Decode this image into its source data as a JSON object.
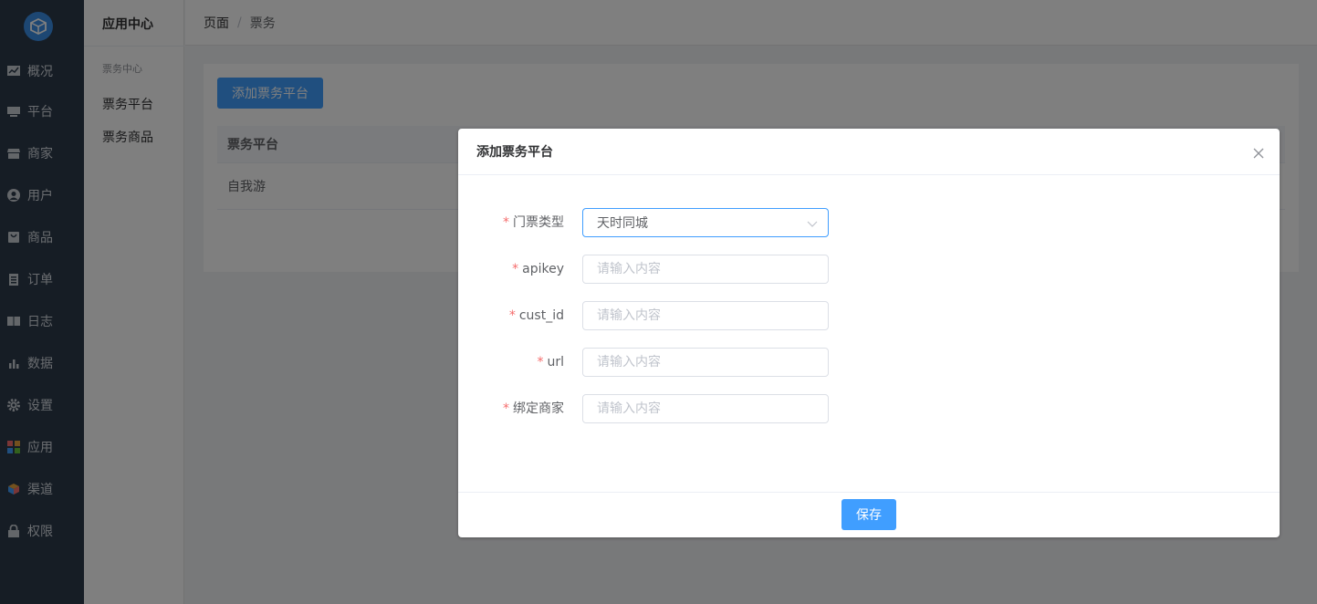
{
  "sidebar": {
    "items": [
      {
        "label": "概况",
        "icon": "chart-icon"
      },
      {
        "label": "平台",
        "icon": "monitor-icon"
      },
      {
        "label": "商家",
        "icon": "shop-icon"
      },
      {
        "label": "用户",
        "icon": "user-icon"
      },
      {
        "label": "商品",
        "icon": "bag-icon"
      },
      {
        "label": "订单",
        "icon": "clipboard-icon"
      },
      {
        "label": "日志",
        "icon": "book-icon"
      },
      {
        "label": "数据",
        "icon": "bar-chart-icon"
      },
      {
        "label": "设置",
        "icon": "gear-icon"
      },
      {
        "label": "应用",
        "icon": "grid-apps-icon"
      },
      {
        "label": "渠道",
        "icon": "cube-icon"
      },
      {
        "label": "权限",
        "icon": "lock-icon"
      }
    ]
  },
  "subnav": {
    "title": "应用中心",
    "group": "票务中心",
    "items": [
      "票务平台",
      "票务商品"
    ]
  },
  "breadcrumb": {
    "root": "页面",
    "separator": "/",
    "current": "票务"
  },
  "main": {
    "add_button": "添加票务平台",
    "table": {
      "header": "票务平台",
      "rows": [
        "自我游"
      ]
    }
  },
  "dialog": {
    "title": "添加票务平台",
    "fields": [
      {
        "label": "门票类型",
        "type": "select",
        "value": "天时同城"
      },
      {
        "label": "apikey",
        "type": "input",
        "placeholder": "请输入内容"
      },
      {
        "label": "cust_id",
        "type": "input",
        "placeholder": "请输入内容"
      },
      {
        "label": "url",
        "type": "input",
        "placeholder": "请输入内容"
      },
      {
        "label": "绑定商家",
        "type": "input",
        "placeholder": "请输入内容"
      }
    ],
    "required_mark": "*",
    "save_label": "保存"
  },
  "colors": {
    "sidebar_bg": "#2d3a4b",
    "primary": "#409eff",
    "required": "#f56c6c"
  }
}
